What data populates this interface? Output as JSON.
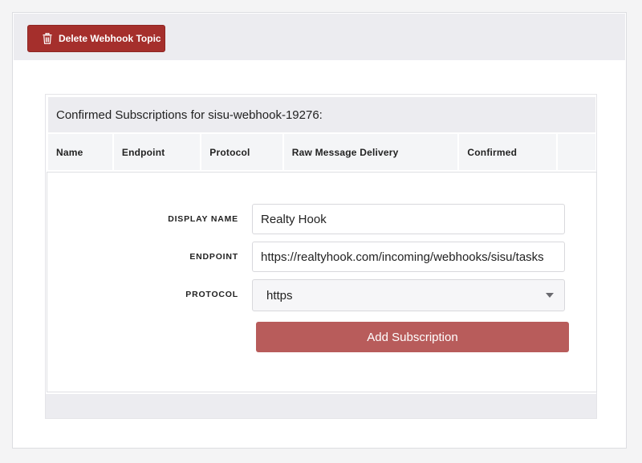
{
  "toolbar": {
    "delete_label": "Delete Webhook Topic",
    "delete_icon": "trash-icon"
  },
  "panel": {
    "title": "Confirmed Subscriptions for sisu-webhook-19276:",
    "columns": [
      "Name",
      "Endpoint",
      "Protocol",
      "Raw Message Delivery",
      "Confirmed",
      ""
    ]
  },
  "form": {
    "display_name_label": "DISPLAY NAME",
    "display_name_value": "Realty Hook",
    "endpoint_label": "ENDPOINT",
    "endpoint_value": "https://realtyhook.com/incoming/webhooks/sisu/tasks",
    "protocol_label": "PROTOCOL",
    "protocol_value": "https",
    "submit_label": "Add Subscription"
  },
  "colors": {
    "danger": "#a52f2c",
    "submit": "#b85c5b",
    "panel_bg": "#ececf0"
  }
}
